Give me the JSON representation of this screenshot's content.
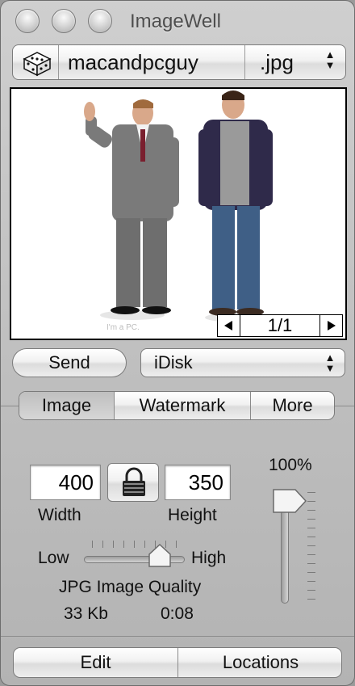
{
  "window": {
    "title": "ImageWell"
  },
  "file": {
    "name": "macandpcguy",
    "extension": ".jpg",
    "icon": "dice-icon"
  },
  "preview": {
    "caption": "I'm a PC.",
    "page_indicator": "1/1"
  },
  "send": {
    "button_label": "Send",
    "destination": "iDisk"
  },
  "tabs": [
    {
      "label": "Image",
      "selected": true
    },
    {
      "label": "Watermark",
      "selected": false
    },
    {
      "label": "More",
      "selected": false
    }
  ],
  "image_settings": {
    "width_value": "400",
    "height_value": "350",
    "width_label": "Width",
    "height_label": "Height",
    "lock_icon": "padlock-icon",
    "quality_low_label": "Low",
    "quality_high_label": "High",
    "quality_caption": "JPG Image Quality",
    "quality_level": 0.75,
    "file_size": "33 Kb",
    "upload_time": "0:08",
    "zoom_label": "100%",
    "zoom_level": 1.0
  },
  "footer": {
    "edit_label": "Edit",
    "locations_label": "Locations"
  },
  "colors": {
    "window_bg": "#bdbdbd",
    "frame_border": "#000000"
  }
}
